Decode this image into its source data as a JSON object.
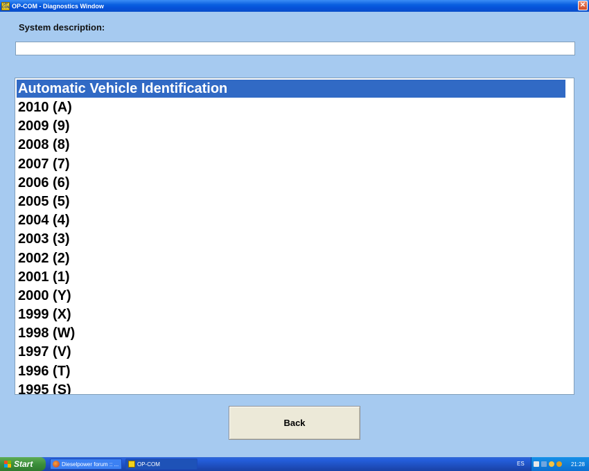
{
  "window": {
    "title": "OP-COM - Diagnostics Window",
    "app_icon_text": "OP COM",
    "close_label": "✕"
  },
  "system": {
    "label": "System description:",
    "value": ""
  },
  "list": {
    "selected_index": 0,
    "items": [
      "Automatic Vehicle Identification",
      "2010 (A)",
      "2009 (9)",
      "2008 (8)",
      "2007 (7)",
      "2006 (6)",
      "2005 (5)",
      "2004 (4)",
      "2003 (3)",
      "2002 (2)",
      "2001 (1)",
      "2000 (Y)",
      "1999 (X)",
      "1998 (W)",
      "1997 (V)",
      "1996 (T)",
      "1995 (S)"
    ]
  },
  "buttons": {
    "back_label": "Back"
  },
  "taskbar": {
    "start_label": "Start",
    "tasks": [
      {
        "label": "Dieselpower forum :: ...",
        "icon": "firefox-icon"
      },
      {
        "label": "OP-COM",
        "icon": "opcom-icon"
      }
    ],
    "language": "ES",
    "clock": "21:28"
  },
  "colors": {
    "background": "#a6caf0",
    "selection": "#316ac5",
    "titlebar": "#0a5fe0"
  }
}
